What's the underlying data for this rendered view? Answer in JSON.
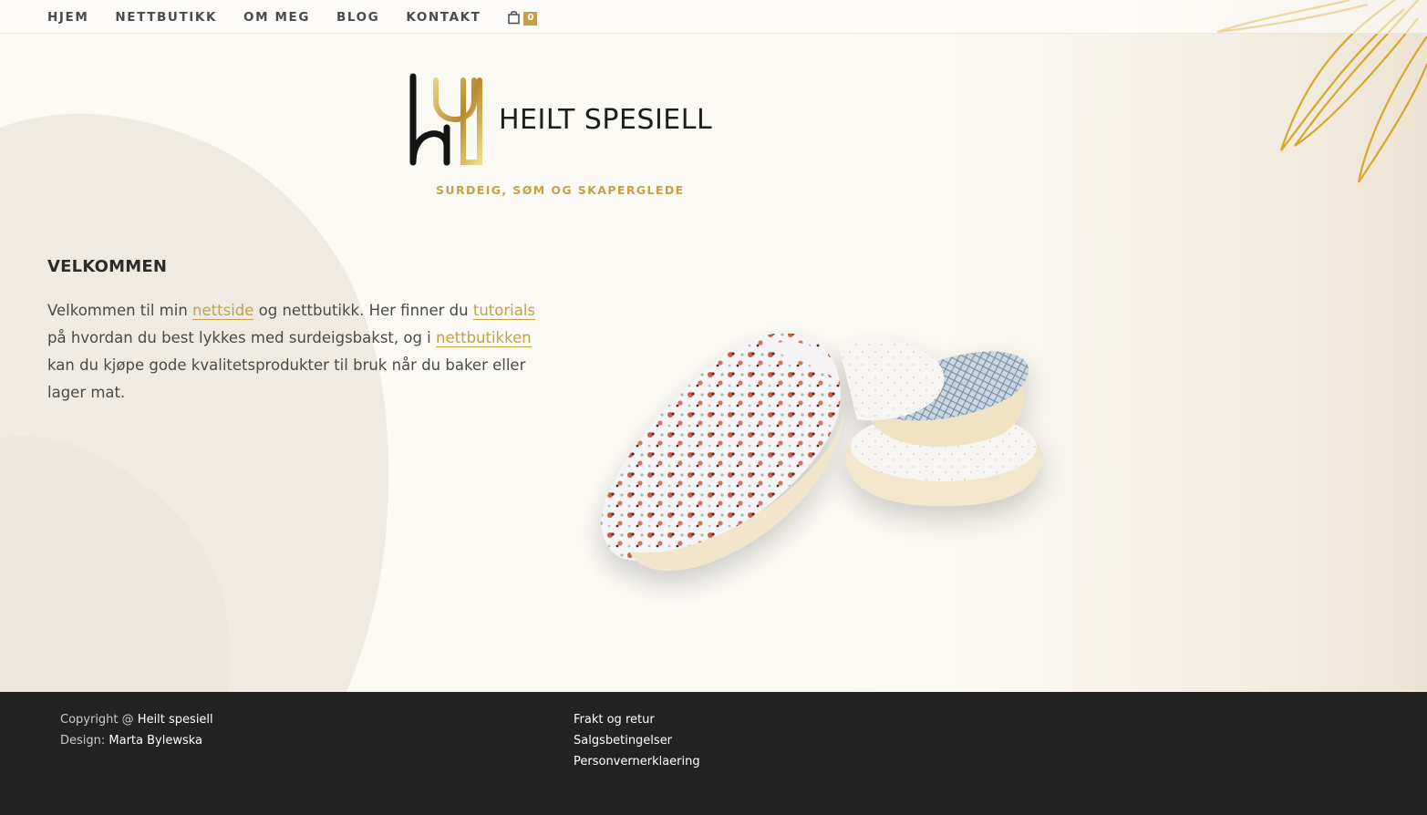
{
  "nav": {
    "items": [
      {
        "label": "HJEM"
      },
      {
        "label": "NETTBUTIKK"
      },
      {
        "label": "OM MEG"
      },
      {
        "label": "BLOG"
      },
      {
        "label": "KONTAKT"
      }
    ],
    "cart_icon": "shopping-bag-icon",
    "cart_count": "0"
  },
  "logo": {
    "name": "HEILT SPESIELL",
    "tagline": "SURDEIG, SØM OG SKAPERGLEDE"
  },
  "intro": {
    "title": "VELKOMMEN",
    "text_1": "Velkommen til min ",
    "link_1": "nettside",
    "text_2": " og nettbutikk. Her finner du ",
    "link_2": "tutorials",
    "text_3": " på hvordan du best lykkes med surdeigsbakst, og i ",
    "link_3": "nettbutikken",
    "text_4": " kan du kjøpe gode kvalitetsprodukter til bruk når du baker eller lager mat."
  },
  "footer": {
    "copyright_label": "Copyright @ ",
    "copyright_value": "Heilt spesiell",
    "design_label": "Design: ",
    "design_value": "Marta Bylewska",
    "links": [
      {
        "label": "Frakt og retur"
      },
      {
        "label": "Salgsbetingelser"
      },
      {
        "label": "Personvernerklaering"
      }
    ]
  },
  "colors": {
    "accent_gold": "#c4a14a",
    "footer_bg": "#232323",
    "page_bg": "#fbf9f4"
  }
}
